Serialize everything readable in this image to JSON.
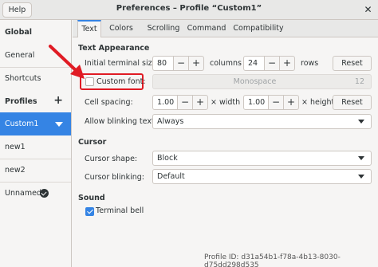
{
  "window": {
    "help_label": "Help",
    "title": "Preferences – Profile “Custom1”",
    "close_glyph": "✕"
  },
  "sidebar": {
    "global_heading": "Global",
    "general": "General",
    "shortcuts": "Shortcuts",
    "profiles_heading": "Profiles",
    "add_glyph": "+",
    "profiles": [
      {
        "label": "Custom1",
        "selected": true
      },
      {
        "label": "new1"
      },
      {
        "label": "new2"
      },
      {
        "label": "Unnamed",
        "default": true
      }
    ]
  },
  "tabs": [
    "Text",
    "Colors",
    "Scrolling",
    "Command",
    "Compatibility"
  ],
  "text_appearance": {
    "heading": "Text Appearance",
    "initial_size_label": "Initial terminal size:",
    "columns_value": "80",
    "columns_label": "columns",
    "rows_value": "24",
    "rows_label": "rows",
    "reset_label": "Reset",
    "custom_font_label": "Custom font:",
    "custom_font_checked": false,
    "font_name": "Monospace",
    "font_size": "12",
    "cell_spacing_label": "Cell spacing:",
    "width_value": "1.00",
    "width_label": "× width",
    "height_value": "1.00",
    "height_label": "× height",
    "blink_label": "Allow blinking text:",
    "blink_value": "Always"
  },
  "cursor": {
    "heading": "Cursor",
    "shape_label": "Cursor shape:",
    "shape_value": "Block",
    "blinking_label": "Cursor blinking:",
    "blinking_value": "Default"
  },
  "sound": {
    "heading": "Sound",
    "bell_label": "Terminal bell",
    "bell_checked": true
  },
  "spin": {
    "minus": "−",
    "plus": "+"
  },
  "footer": {
    "profile_id_label": "Profile ID:",
    "profile_id": "d31a54b1-f78a-4b13-8030-d75dd298d535"
  },
  "annotation_color": "#e01b24",
  "accent_color": "#3584e4"
}
